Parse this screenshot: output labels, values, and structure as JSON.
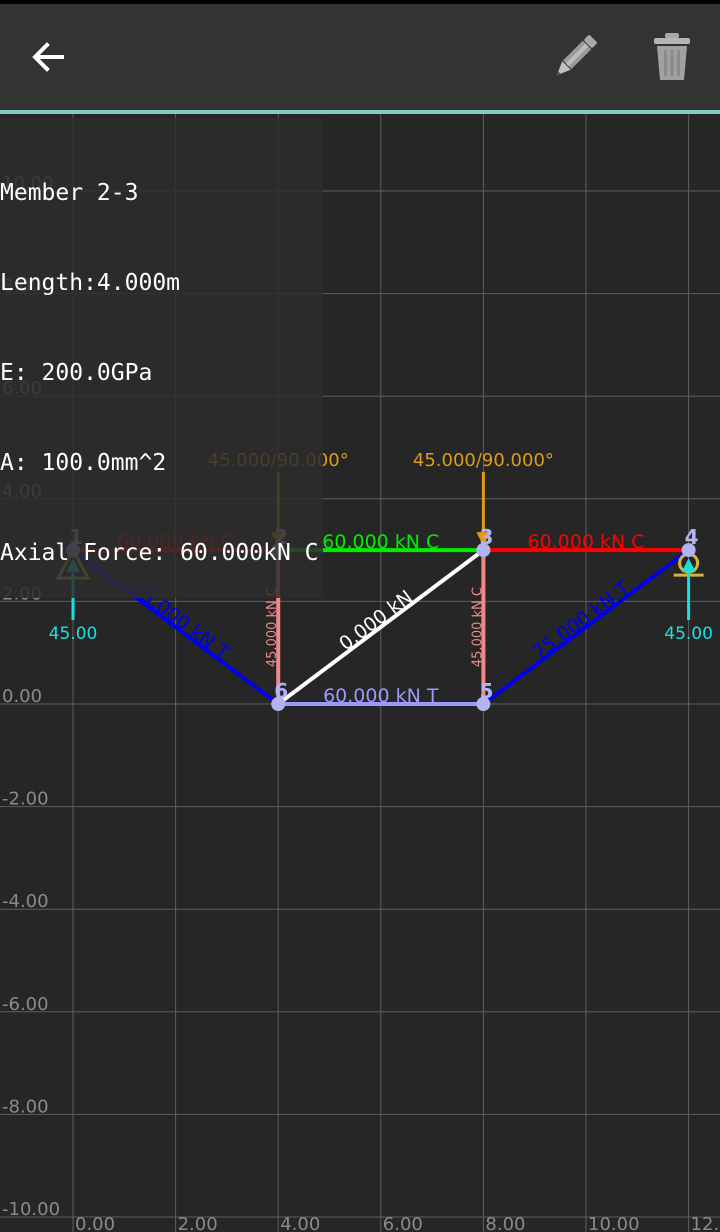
{
  "toolbar": {
    "back_icon": "arrow-left-icon",
    "edit_icon": "pencil-icon",
    "delete_icon": "trash-icon",
    "accent_color": "#80cbc4"
  },
  "info_panel": {
    "member": "Member 2-3",
    "length": "Length:4.000m",
    "modulus": "E: 200.0GPa",
    "area": "A: 100.0mm^2",
    "axial_force": "Axial Force: 60.000kN C"
  },
  "grid": {
    "x_ticks": [
      "0.00",
      "2.00",
      "4.00",
      "6.00",
      "8.00",
      "10.00",
      "12."
    ],
    "y_ticks": [
      "10.00",
      "8.00",
      "6.00",
      "4.00",
      "2.00",
      "0.00",
      "-2.00",
      "-4.00",
      "-6.00",
      "-8.00",
      "-10.00"
    ]
  },
  "truss": {
    "nodes": [
      {
        "id": "1",
        "x": 0,
        "y": 3
      },
      {
        "id": "2",
        "x": 4,
        "y": 3
      },
      {
        "id": "3",
        "x": 8,
        "y": 3
      },
      {
        "id": "4",
        "x": 12,
        "y": 3
      },
      {
        "id": "5",
        "x": 8,
        "y": 0
      },
      {
        "id": "6",
        "x": 4,
        "y": 0
      }
    ],
    "members": [
      {
        "from": 0,
        "to": 1,
        "label": "60.000 kN C",
        "color": "#ff0000",
        "small": false
      },
      {
        "from": 1,
        "to": 2,
        "label": "60.000 kN C",
        "color": "#00ee00",
        "small": false
      },
      {
        "from": 2,
        "to": 3,
        "label": "60.000 kN C",
        "color": "#ff0000",
        "small": false
      },
      {
        "from": 0,
        "to": 5,
        "label": "75.000 kN T",
        "color": "#0000ee",
        "small": false
      },
      {
        "from": 5,
        "to": 1,
        "label": "45.000 kN C",
        "color": "#f08888",
        "small": true
      },
      {
        "from": 5,
        "to": 2,
        "label": "0.000 kN",
        "color": "#ffffff",
        "small": false
      },
      {
        "from": 5,
        "to": 4,
        "label": "60.000 kN T",
        "color": "#9999ff",
        "small": false
      },
      {
        "from": 4,
        "to": 2,
        "label": "45.000 kN C",
        "color": "#f08888",
        "small": true
      },
      {
        "from": 4,
        "to": 3,
        "label": "75.000 kN T",
        "color": "#0000ee",
        "small": false
      }
    ],
    "loads": [
      {
        "node": 1,
        "label": "45.000/90.000°"
      },
      {
        "node": 2,
        "label": "45.000/90.000°"
      }
    ],
    "reactions": [
      {
        "node": 0,
        "value": "45.00"
      },
      {
        "node": 3,
        "value": "45.00"
      }
    ],
    "colors": {
      "node": "#b3b3f2",
      "load": "#e09a1a",
      "reaction": "#19e0e0",
      "support": "#d8b440",
      "grid": "#5e5e5e",
      "tick": "#8a8a8a"
    }
  }
}
